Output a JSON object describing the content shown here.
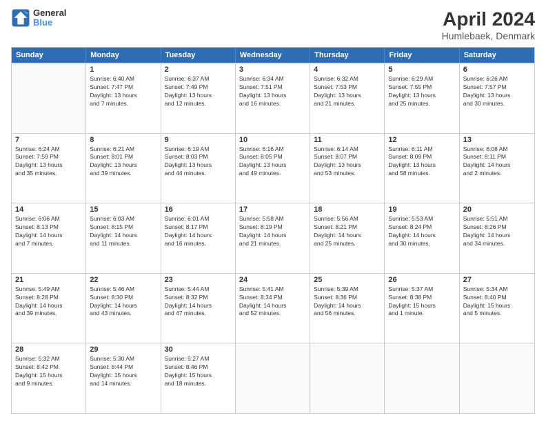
{
  "header": {
    "logo_line1": "General",
    "logo_line2": "Blue",
    "title": "April 2024",
    "subtitle": "Humlebaek, Denmark"
  },
  "days_of_week": [
    "Sunday",
    "Monday",
    "Tuesday",
    "Wednesday",
    "Thursday",
    "Friday",
    "Saturday"
  ],
  "weeks": [
    [
      {
        "day": "",
        "info": ""
      },
      {
        "day": "1",
        "info": "Sunrise: 6:40 AM\nSunset: 7:47 PM\nDaylight: 13 hours\nand 7 minutes."
      },
      {
        "day": "2",
        "info": "Sunrise: 6:37 AM\nSunset: 7:49 PM\nDaylight: 13 hours\nand 12 minutes."
      },
      {
        "day": "3",
        "info": "Sunrise: 6:34 AM\nSunset: 7:51 PM\nDaylight: 13 hours\nand 16 minutes."
      },
      {
        "day": "4",
        "info": "Sunrise: 6:32 AM\nSunset: 7:53 PM\nDaylight: 13 hours\nand 21 minutes."
      },
      {
        "day": "5",
        "info": "Sunrise: 6:29 AM\nSunset: 7:55 PM\nDaylight: 13 hours\nand 25 minutes."
      },
      {
        "day": "6",
        "info": "Sunrise: 6:26 AM\nSunset: 7:57 PM\nDaylight: 13 hours\nand 30 minutes."
      }
    ],
    [
      {
        "day": "7",
        "info": "Sunrise: 6:24 AM\nSunset: 7:59 PM\nDaylight: 13 hours\nand 35 minutes."
      },
      {
        "day": "8",
        "info": "Sunrise: 6:21 AM\nSunset: 8:01 PM\nDaylight: 13 hours\nand 39 minutes."
      },
      {
        "day": "9",
        "info": "Sunrise: 6:19 AM\nSunset: 8:03 PM\nDaylight: 13 hours\nand 44 minutes."
      },
      {
        "day": "10",
        "info": "Sunrise: 6:16 AM\nSunset: 8:05 PM\nDaylight: 13 hours\nand 49 minutes."
      },
      {
        "day": "11",
        "info": "Sunrise: 6:14 AM\nSunset: 8:07 PM\nDaylight: 13 hours\nand 53 minutes."
      },
      {
        "day": "12",
        "info": "Sunrise: 6:11 AM\nSunset: 8:09 PM\nDaylight: 13 hours\nand 58 minutes."
      },
      {
        "day": "13",
        "info": "Sunrise: 6:08 AM\nSunset: 8:11 PM\nDaylight: 14 hours\nand 2 minutes."
      }
    ],
    [
      {
        "day": "14",
        "info": "Sunrise: 6:06 AM\nSunset: 8:13 PM\nDaylight: 14 hours\nand 7 minutes."
      },
      {
        "day": "15",
        "info": "Sunrise: 6:03 AM\nSunset: 8:15 PM\nDaylight: 14 hours\nand 11 minutes."
      },
      {
        "day": "16",
        "info": "Sunrise: 6:01 AM\nSunset: 8:17 PM\nDaylight: 14 hours\nand 16 minutes."
      },
      {
        "day": "17",
        "info": "Sunrise: 5:58 AM\nSunset: 8:19 PM\nDaylight: 14 hours\nand 21 minutes."
      },
      {
        "day": "18",
        "info": "Sunrise: 5:56 AM\nSunset: 8:21 PM\nDaylight: 14 hours\nand 25 minutes."
      },
      {
        "day": "19",
        "info": "Sunrise: 5:53 AM\nSunset: 8:24 PM\nDaylight: 14 hours\nand 30 minutes."
      },
      {
        "day": "20",
        "info": "Sunrise: 5:51 AM\nSunset: 8:26 PM\nDaylight: 14 hours\nand 34 minutes."
      }
    ],
    [
      {
        "day": "21",
        "info": "Sunrise: 5:49 AM\nSunset: 8:28 PM\nDaylight: 14 hours\nand 39 minutes."
      },
      {
        "day": "22",
        "info": "Sunrise: 5:46 AM\nSunset: 8:30 PM\nDaylight: 14 hours\nand 43 minutes."
      },
      {
        "day": "23",
        "info": "Sunrise: 5:44 AM\nSunset: 8:32 PM\nDaylight: 14 hours\nand 47 minutes."
      },
      {
        "day": "24",
        "info": "Sunrise: 5:41 AM\nSunset: 8:34 PM\nDaylight: 14 hours\nand 52 minutes."
      },
      {
        "day": "25",
        "info": "Sunrise: 5:39 AM\nSunset: 8:36 PM\nDaylight: 14 hours\nand 56 minutes."
      },
      {
        "day": "26",
        "info": "Sunrise: 5:37 AM\nSunset: 8:38 PM\nDaylight: 15 hours\nand 1 minute."
      },
      {
        "day": "27",
        "info": "Sunrise: 5:34 AM\nSunset: 8:40 PM\nDaylight: 15 hours\nand 5 minutes."
      }
    ],
    [
      {
        "day": "28",
        "info": "Sunrise: 5:32 AM\nSunset: 8:42 PM\nDaylight: 15 hours\nand 9 minutes."
      },
      {
        "day": "29",
        "info": "Sunrise: 5:30 AM\nSunset: 8:44 PM\nDaylight: 15 hours\nand 14 minutes."
      },
      {
        "day": "30",
        "info": "Sunrise: 5:27 AM\nSunset: 8:46 PM\nDaylight: 15 hours\nand 18 minutes."
      },
      {
        "day": "",
        "info": ""
      },
      {
        "day": "",
        "info": ""
      },
      {
        "day": "",
        "info": ""
      },
      {
        "day": "",
        "info": ""
      }
    ]
  ]
}
